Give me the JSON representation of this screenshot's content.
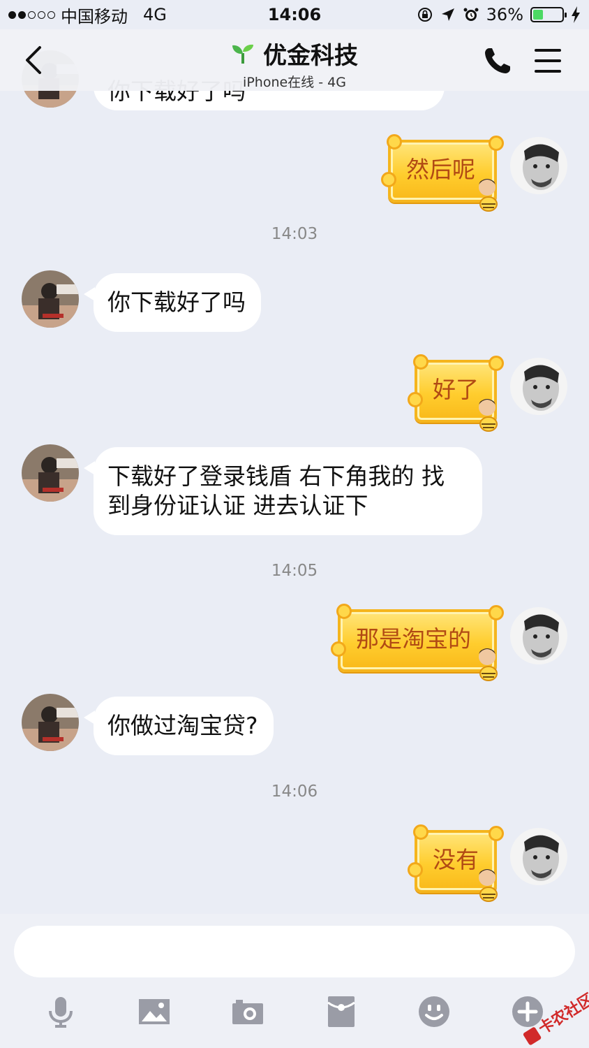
{
  "status_bar": {
    "carrier": "中国移动",
    "network": "4G",
    "time": "14:06",
    "battery": "36%",
    "battery_level": 0.36,
    "battery_color": "#4cd964"
  },
  "nav": {
    "title": "优金科技",
    "subtitle": "iPhone在线 - 4G",
    "icons": [
      "back-chevron-icon",
      "sprout-icon",
      "phone-icon",
      "menu-icon"
    ]
  },
  "messages": [
    {
      "from": "them",
      "text": "你下载好了吗"
    },
    {
      "from": "me",
      "text": "然后呢",
      "style": "honey-sticker"
    },
    {
      "time": "14:03"
    },
    {
      "from": "them",
      "text": "你下载好了吗"
    },
    {
      "from": "me",
      "text": "好了",
      "style": "honey-sticker"
    },
    {
      "from": "them",
      "text": "下载好了登录钱盾 右下角我的 找到身份证认证 进去认证下"
    },
    {
      "time": "14:05"
    },
    {
      "from": "me",
      "text": "那是淘宝的",
      "style": "honey-sticker"
    },
    {
      "from": "them",
      "text": "你做过淘宝贷?"
    },
    {
      "time": "14:06"
    },
    {
      "from": "me",
      "text": "没有",
      "style": "honey-sticker"
    }
  ],
  "chat": {
    "partial_top_text": "你下载好了吗",
    "msg_then": "然后呢",
    "time1": "14:03",
    "msg_downloaded": "你下载好了吗",
    "msg_ok": "好了",
    "msg_instructions_line1": "下载好了登录钱盾 右下角我的 找",
    "msg_instructions_line2": "到身份证认证 进去认证下",
    "time2": "14:05",
    "msg_taobao": "那是淘宝的",
    "msg_loan": "你做过淘宝贷?",
    "time3": "14:06",
    "msg_no": "没有"
  },
  "input": {
    "value": "",
    "placeholder": ""
  },
  "toolbar": {
    "icons": [
      "microphone-icon",
      "image-icon",
      "camera-icon",
      "red-envelope-icon",
      "emoji-icon",
      "plus-icon"
    ]
  },
  "watermark": "卡农社区",
  "colors": {
    "background": "#eaedf5",
    "bubble": "#ffffff",
    "honey_fill": "#ffcd2e",
    "honey_text": "#b14a14",
    "icon_gray": "#9a9ca6"
  }
}
